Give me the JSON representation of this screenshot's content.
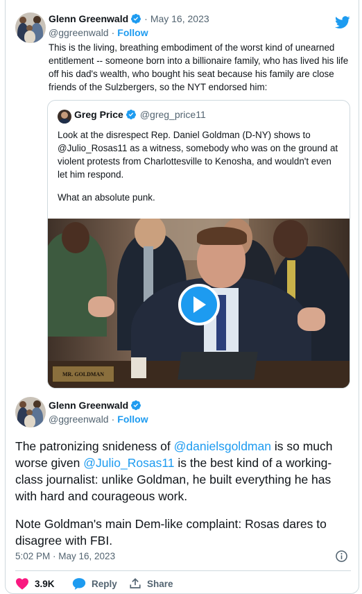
{
  "embed": {
    "top": {
      "author_name": "Glenn Greenwald",
      "date": "May 16, 2023",
      "handle": "@ggreenwald",
      "follow_label": "Follow",
      "text": "This is the living, breathing embodiment of the worst kind of unearned entitlement  -- someone born into a billionaire family, who has lived his life off his dad's wealth, who bought his seat because his family are close friends of the Sulzbergers, so the NYT endorsed him:"
    },
    "quote": {
      "author_name": "Greg Price",
      "handle": "@greg_price11",
      "text_line1": "Look at the disrespect Rep. Daniel Goldman (D-NY) shows to @Julio_Rosas11 as a witness, somebody who was on the ground at violent protests from Charlottesville to Kenosha, and wouldn't even let him respond.",
      "text_line2": "What an absolute punk.",
      "nameplate": "MR. GOLDMAN"
    },
    "main": {
      "author_name": "Glenn Greenwald",
      "handle": "@ggreenwald",
      "follow_label": "Follow",
      "p1_a": "The patronizing snideness of ",
      "p1_mention1": "@danielsgoldman",
      "p1_b": " is so much worse given ",
      "p1_mention2": "@Julio_Rosas11",
      "p1_c": " is the best kind of a working-class journalist: unlike Goldman, he built everything he has with hard and courageous work.",
      "p2": "Note Goldman's main Dem-like complaint: Rosas dares to disagree with FBI.",
      "timestamp": "5:02 PM · May 16, 2023"
    },
    "actions": {
      "likes": "3.9K",
      "reply_label": "Reply",
      "share_label": "Share"
    }
  },
  "colors": {
    "accent": "#1d9bf0",
    "like": "#f91880",
    "muted": "#536471"
  },
  "icons": [
    "twitter-bird-icon",
    "verified-badge-icon",
    "play-icon",
    "info-icon",
    "heart-icon",
    "reply-icon",
    "share-icon"
  ]
}
